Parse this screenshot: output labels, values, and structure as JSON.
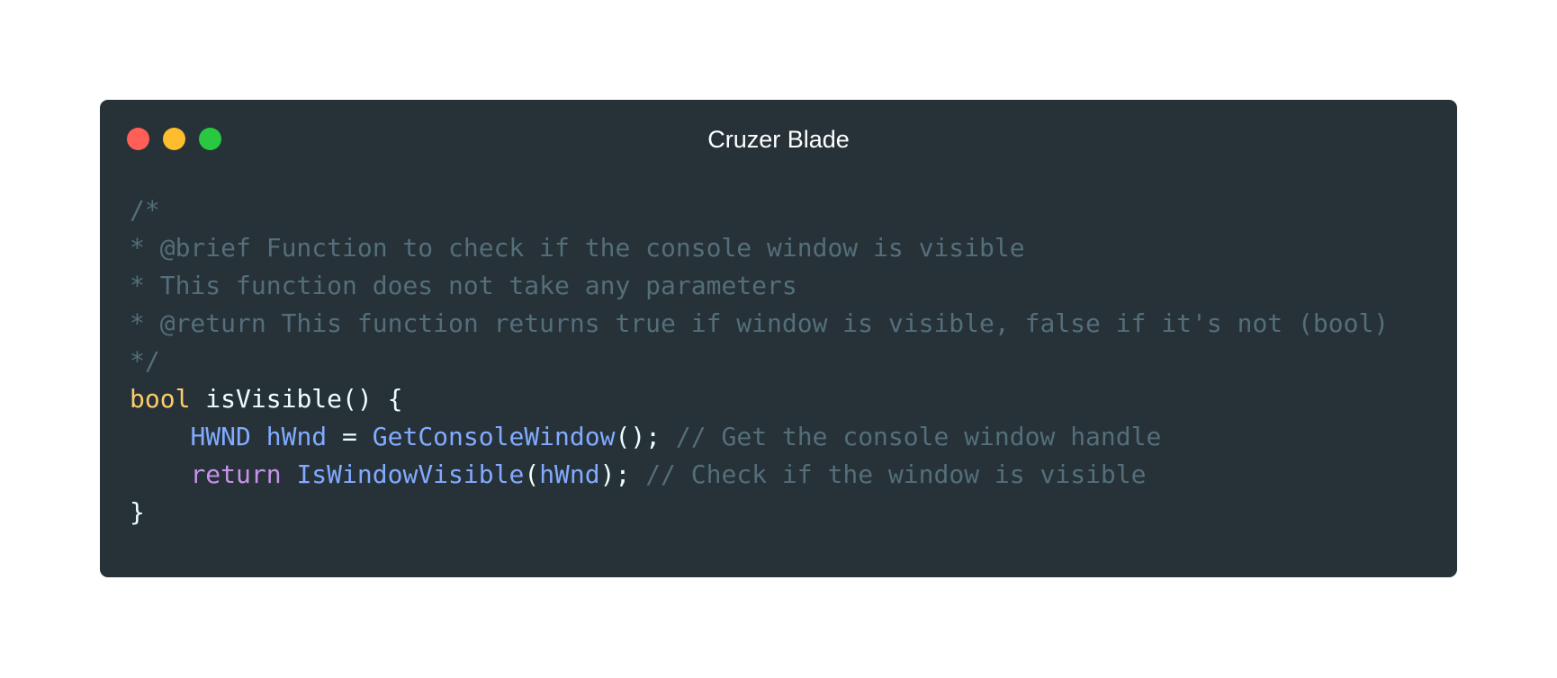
{
  "window": {
    "title": "Cruzer Blade"
  },
  "colors": {
    "window_background": "#263238",
    "close": "#ff5f57",
    "minimize": "#febc2e",
    "zoom": "#28c840",
    "comment": "#546e7a",
    "type": "#ffcb6b",
    "plain": "#eeffff",
    "identifier": "#82aaff",
    "keyword": "#c792ea"
  },
  "code": {
    "language": "cpp",
    "lines": [
      {
        "tokens": [
          {
            "t": "/*",
            "k": "comment"
          }
        ]
      },
      {
        "tokens": [
          {
            "t": "* @brief Function to check if the console window is visible",
            "k": "comment"
          }
        ]
      },
      {
        "tokens": [
          {
            "t": "* This function does not take any parameters",
            "k": "comment"
          }
        ]
      },
      {
        "tokens": [
          {
            "t": "* @return This function returns true if window is visible, false if it's not (bool)",
            "k": "comment"
          }
        ]
      },
      {
        "tokens": [
          {
            "t": "*/",
            "k": "comment"
          }
        ]
      },
      {
        "tokens": [
          {
            "t": "bool",
            "k": "type"
          },
          {
            "t": " isVisible() {",
            "k": "plain"
          }
        ]
      },
      {
        "tokens": [
          {
            "t": "    ",
            "k": "plain"
          },
          {
            "t": "HWND",
            "k": "ident"
          },
          {
            "t": " ",
            "k": "plain"
          },
          {
            "t": "hWnd",
            "k": "ident"
          },
          {
            "t": " = ",
            "k": "plain"
          },
          {
            "t": "GetConsoleWindow",
            "k": "ident"
          },
          {
            "t": "(); ",
            "k": "plain"
          },
          {
            "t": "// Get the console window handle",
            "k": "comment"
          }
        ]
      },
      {
        "tokens": [
          {
            "t": "    ",
            "k": "plain"
          },
          {
            "t": "return",
            "k": "keyword"
          },
          {
            "t": " ",
            "k": "plain"
          },
          {
            "t": "IsWindowVisible",
            "k": "ident"
          },
          {
            "t": "(",
            "k": "plain"
          },
          {
            "t": "hWnd",
            "k": "ident"
          },
          {
            "t": "); ",
            "k": "plain"
          },
          {
            "t": "// Check if the window is visible",
            "k": "comment"
          }
        ]
      },
      {
        "tokens": [
          {
            "t": "}",
            "k": "plain"
          }
        ]
      }
    ]
  }
}
